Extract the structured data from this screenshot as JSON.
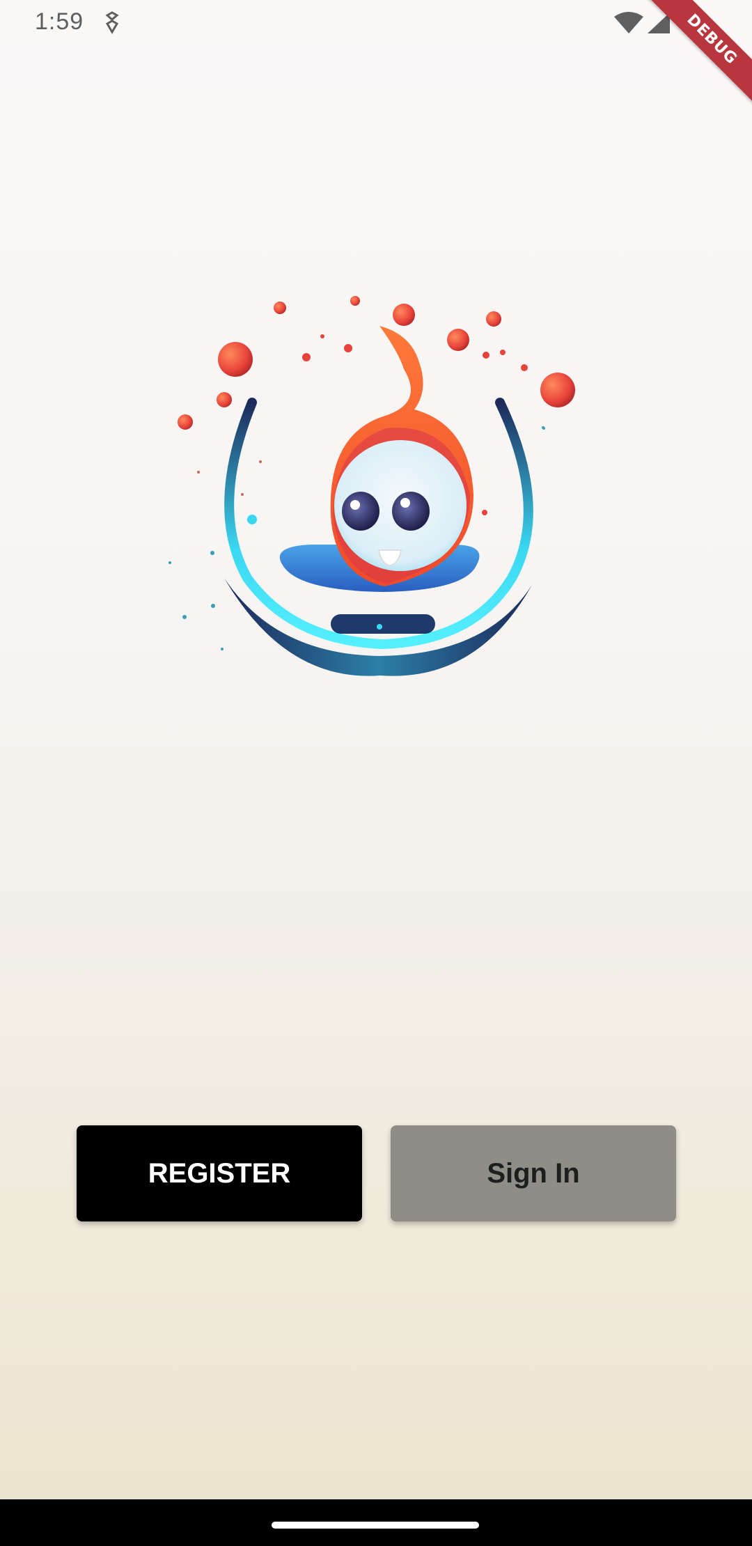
{
  "status_bar": {
    "time": "1:59",
    "icons": [
      "sim-card-icon",
      "wifi-icon",
      "cellular-signal-icon"
    ]
  },
  "debug_banner": {
    "label": "DEBUG",
    "color": "#b8363e"
  },
  "logo": {
    "description_icon": "flame-mascot-logo-icon",
    "colors": {
      "flame": "#f15a29",
      "ring": "#3ad7f0",
      "ring_dark": "#1d2a5a",
      "face": "#e8f2f8",
      "orbs": "#e8433a"
    }
  },
  "actions": {
    "register_label": "REGISTER",
    "sign_in_label": "Sign In",
    "register_color": "#000000",
    "sign_in_color": "#8f8e86"
  },
  "nav_bar": {
    "color": "#000000"
  }
}
